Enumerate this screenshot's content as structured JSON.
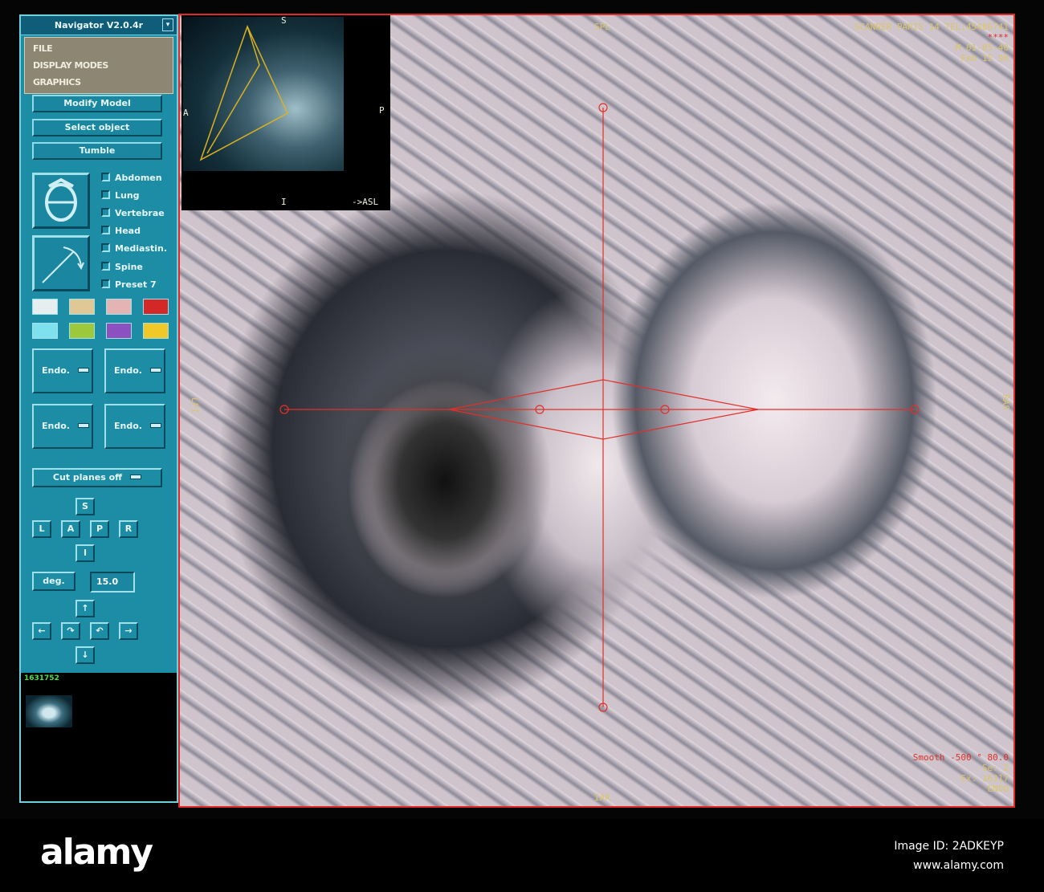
{
  "panel": {
    "title": "Navigator V2.0.4r",
    "menu": [
      "FILE",
      "DISPLAY MODES",
      "GRAPHICS"
    ],
    "buttons": [
      "Modify Model",
      "Select object",
      "Tumble"
    ],
    "icons": [
      "tumble-rotate-icon",
      "rotate-arc-icon"
    ],
    "checkboxes": [
      "Abdomen",
      "Lung",
      "Vertebrae",
      "Head",
      "Mediastin.",
      "Spine",
      "Preset 7"
    ],
    "swatches": [
      "#e6eef0",
      "#e0c896",
      "#e4b4b4",
      "#d42828",
      "#7fe0ee",
      "#9cc83c",
      "#8c50c0",
      "#f0c828"
    ],
    "endo": [
      "Endo.",
      "Endo.",
      "Endo.",
      "Endo."
    ],
    "cut_planes": "Cut planes off",
    "nav": {
      "s": "S",
      "l": "L",
      "a": "A",
      "p": "P",
      "r": "R",
      "i": "I"
    },
    "units": "deg.",
    "angle": "15.0",
    "arrows": {
      "up": "↑",
      "left": "←",
      "ccw": "↷",
      "cw": "↶",
      "right": "→",
      "down": "↓"
    },
    "counter": "1631752"
  },
  "inset": {
    "s": "S",
    "a": "A",
    "p": "P",
    "i": "I",
    "view": "->ASL"
  },
  "viewport": {
    "top": "SPL",
    "bottom": "IAR",
    "left": "LPI",
    "right": "RAS",
    "info": [
      "SCANNER PARIS 14 TEL:45486741",
      "****",
      "M  01-05-40",
      "Feb 15 96"
    ],
    "smooth": "Smooth -500 °  80.0",
    "status": [
      "Se: 2",
      "Ex: 16317",
      "ENDO"
    ],
    "crosshair_color": "#e0302a"
  },
  "watermark": {
    "logo": "alamy",
    "id": "Image ID: 2ADKEYP",
    "url": "www.alamy.com"
  }
}
